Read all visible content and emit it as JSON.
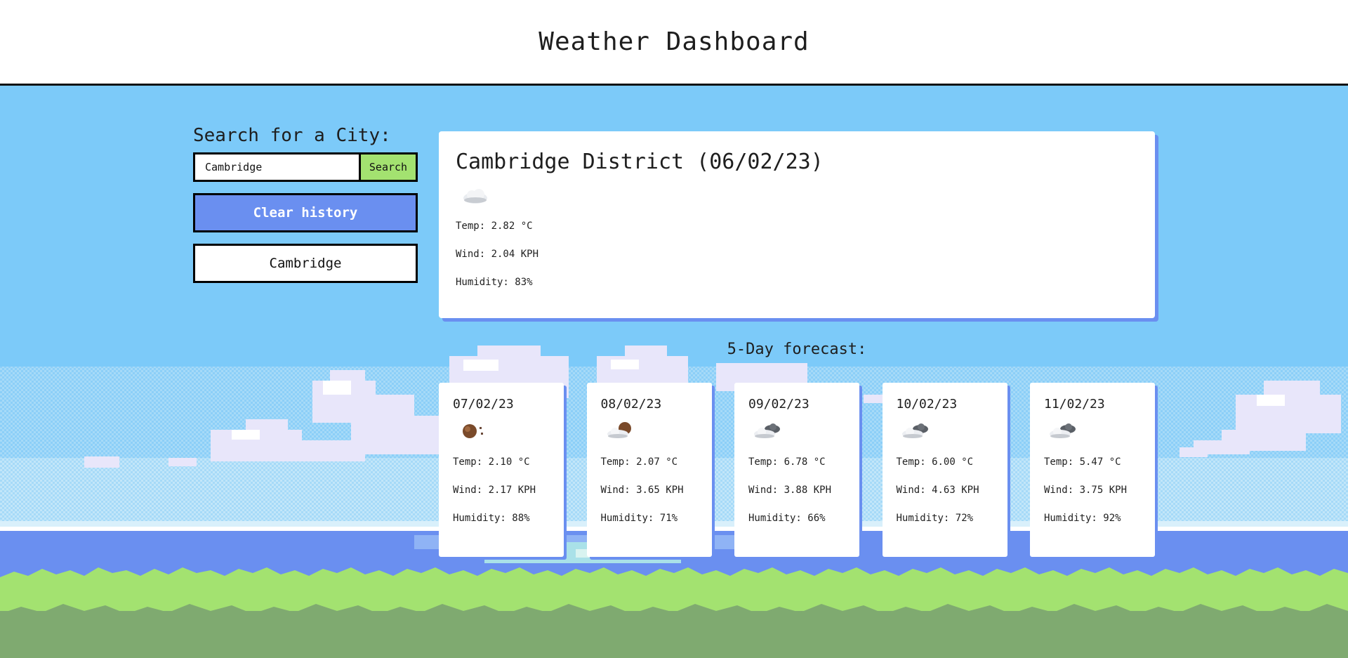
{
  "header": {
    "title": "Weather Dashboard"
  },
  "search": {
    "title": "Search for a City:",
    "input_value": "Cambridge",
    "button_label": "Search",
    "clear_label": "Clear history",
    "history": [
      "Cambridge"
    ]
  },
  "current": {
    "title": "Cambridge District (06/02/23)",
    "icon": "overcast-cloud-icon",
    "temp": "Temp: 2.82 °C",
    "wind": "Wind: 2.04 KPH",
    "humidity": "Humidity: 83%"
  },
  "forecast": {
    "title": "5-Day forecast:",
    "days": [
      {
        "date": "07/02/23",
        "icon": "night-clear-icon",
        "temp": "Temp: 2.10 °C",
        "wind": "Wind: 2.17 KPH",
        "humidity": "Humidity: 88%"
      },
      {
        "date": "08/02/23",
        "icon": "night-few-clouds-icon",
        "temp": "Temp: 2.07 °C",
        "wind": "Wind: 3.65 KPH",
        "humidity": "Humidity: 71%"
      },
      {
        "date": "09/02/23",
        "icon": "broken-clouds-icon",
        "temp": "Temp: 6.78 °C",
        "wind": "Wind: 3.88 KPH",
        "humidity": "Humidity: 66%"
      },
      {
        "date": "10/02/23",
        "icon": "broken-clouds-icon",
        "temp": "Temp: 6.00 °C",
        "wind": "Wind: 4.63 KPH",
        "humidity": "Humidity: 72%"
      },
      {
        "date": "11/02/23",
        "icon": "broken-clouds-icon",
        "temp": "Temp: 5.47 °C",
        "wind": "Wind: 3.75 KPH",
        "humidity": "Humidity: 92%"
      }
    ]
  },
  "colors": {
    "sky": "#7ccaf9",
    "sea": "#6a8ff0",
    "grass": "#a3e270",
    "grass_dark": "#7faa70",
    "search_button": "#a3e270",
    "clear_button": "#6a8ff0"
  }
}
